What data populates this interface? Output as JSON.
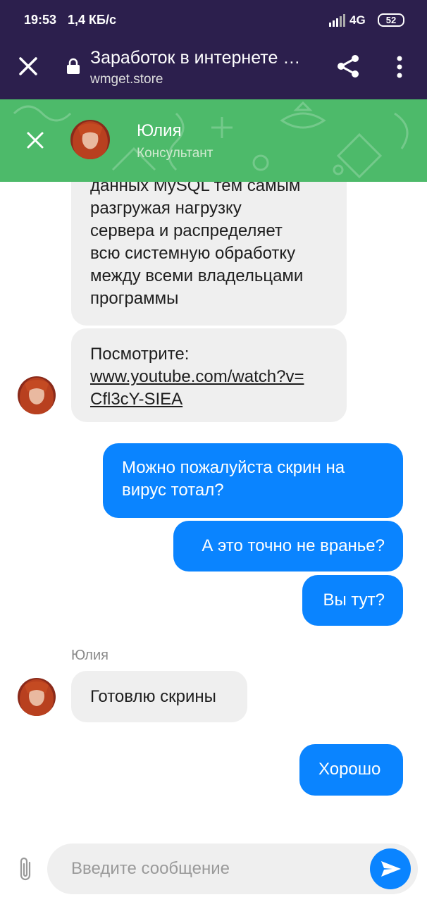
{
  "status_bar": {
    "time": "19:53",
    "speed": "1,4 КБ/с",
    "network": "4G",
    "battery": "52"
  },
  "browser": {
    "page_title": "Заработок в интернете …",
    "url": "wmget.store",
    "icons": [
      "close-icon",
      "lock-icon",
      "share-icon",
      "more-vert-icon"
    ]
  },
  "chat_header": {
    "name": "Юлия",
    "role": "Консультант",
    "color": "#4dba6a"
  },
  "messages": {
    "m1_lines": [
      "данных MySQL тем самым",
      "разгружая нагрузку",
      "сервера и распределяет",
      "всю системную обработку",
      "между всеми владельцами",
      "программы"
    ],
    "m2_text": "Посмотрите:",
    "m2_link_lines": [
      "www.youtube.com/watch?v=",
      "Cfl3cY-SIEA"
    ],
    "m3_lines": [
      "Можно пожалуйста скрин на",
      "вирус тотал?"
    ],
    "m4": "А это точно не вранье?",
    "m5": "Вы тут?",
    "sender_name": "Юлия",
    "m6": "Готовлю скрины",
    "m7": "Хорошо"
  },
  "composer": {
    "placeholder": "Введите сообщение"
  },
  "colors": {
    "toolbar": "#2c1f4d",
    "outgoing": "#0a84ff",
    "incoming": "#efefef"
  }
}
